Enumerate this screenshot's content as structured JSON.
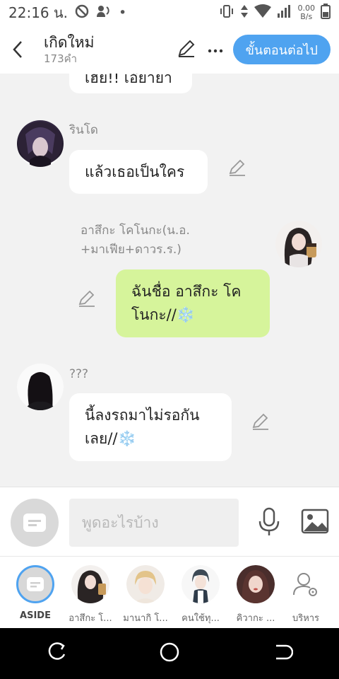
{
  "status": {
    "time": "22:16 น.",
    "net_speed_top": "0.00",
    "net_speed_bottom": "B/s"
  },
  "header": {
    "title": "เกิดใหม่",
    "word_count": "173คำ",
    "next_label": "ขั้นตอนต่อไป"
  },
  "messages": [
    {
      "speaker": "",
      "text": "เฮ้ย!! เอ๊ย่าย่า",
      "side": "left"
    },
    {
      "speaker": "รินโด",
      "text": "แล้วเธอเป็นใคร",
      "side": "left"
    },
    {
      "speaker_line1": "อาสึกะ โคโนกะ(น.อ.",
      "speaker_line2": "+มาเฟีย+ดาวร.ร.)",
      "text_line1": "ฉันชื่อ อาสึกะ โค",
      "text_line2": "โนกะ//❄️",
      "side": "right"
    },
    {
      "speaker": "???",
      "text_line1": "นี้ลงรถมาไม่รอกัน",
      "text_line2": "เลย//❄️",
      "side": "left"
    }
  ],
  "composer": {
    "placeholder": "พูดอะไรบ้าง"
  },
  "characters": [
    {
      "label": "ASIDE"
    },
    {
      "label": "อาสึกะ โ..."
    },
    {
      "label": "มานากิ โ..."
    },
    {
      "label": "คนใช้ทุ..."
    },
    {
      "label": "คิวากะ ..."
    },
    {
      "label": "บริหาร"
    }
  ],
  "colors": {
    "accent": "#4fa3f0",
    "my_bubble": "#d6f49b",
    "background": "#f2f2f2"
  }
}
